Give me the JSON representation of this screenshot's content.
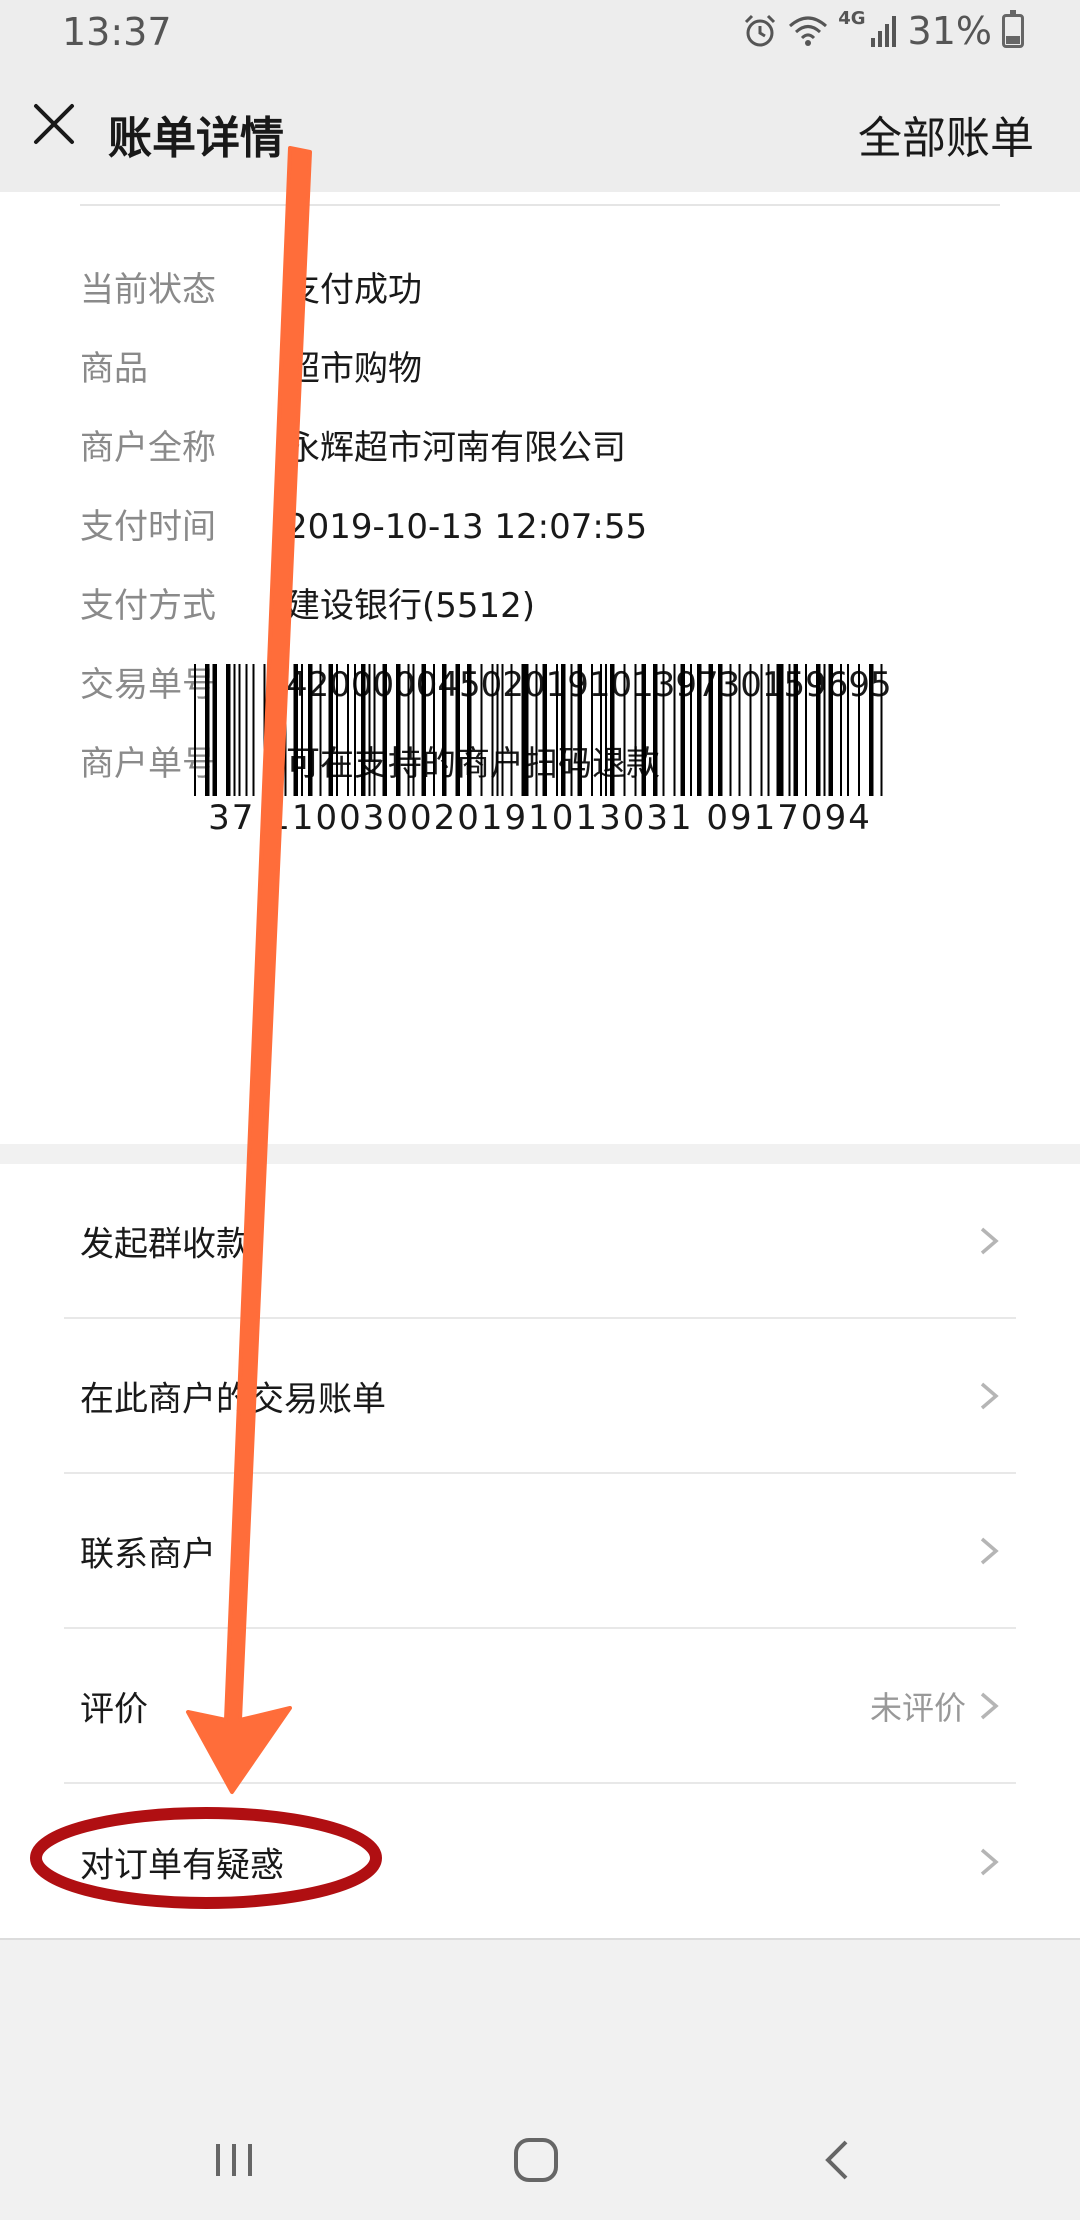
{
  "status": {
    "time": "13:37",
    "network": "4G",
    "battery": "31%"
  },
  "nav": {
    "title": "账单详情",
    "right_link": "全部账单"
  },
  "details": [
    {
      "label": "当前状态",
      "value": "支付成功"
    },
    {
      "label": "商品",
      "value": "超市购物"
    },
    {
      "label": "商户全称",
      "value": "永辉超市河南有限公司"
    },
    {
      "label": "支付时间",
      "value": "2019-10-13 12:07:55"
    },
    {
      "label": "支付方式",
      "value": "建设银行(5512)"
    },
    {
      "label": "交易单号",
      "value": "4200000450201910139730159695"
    },
    {
      "label": "商户单号",
      "value": "可在支持的商户扫码退款"
    }
  ],
  "barcode": {
    "number": "37 110030020191013031 0917094"
  },
  "menu": [
    {
      "label": "发起群收款",
      "right": ""
    },
    {
      "label": "在此商户的交易账单",
      "right": ""
    },
    {
      "label": "联系商户",
      "right": ""
    },
    {
      "label": "评价",
      "right": "未评价"
    },
    {
      "label": "对订单有疑惑",
      "right": ""
    }
  ],
  "colors": {
    "header_bg": "#ededed",
    "arrow": "#ff6d3a",
    "ellipse": "#b00f12",
    "label_gray": "#8a8a8a"
  }
}
